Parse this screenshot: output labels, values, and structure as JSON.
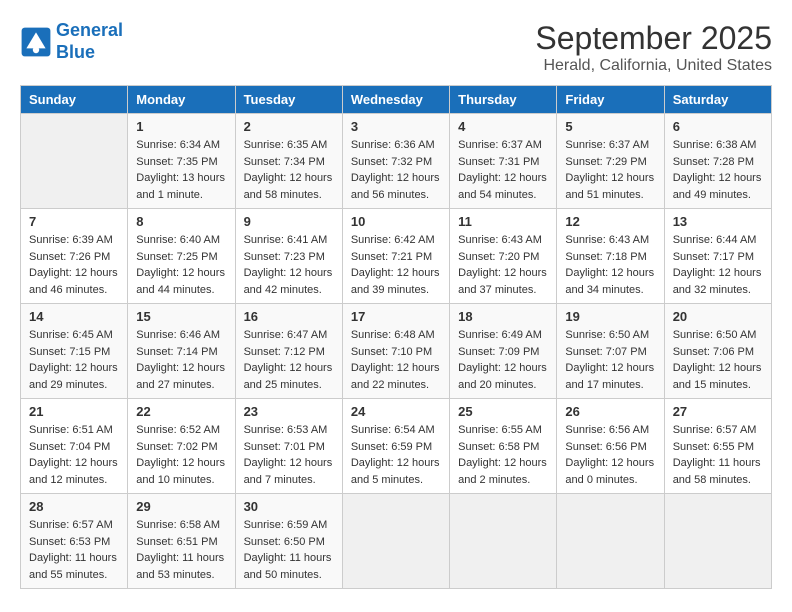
{
  "logo": {
    "line1": "General",
    "line2": "Blue"
  },
  "title": "September 2025",
  "subtitle": "Herald, California, United States",
  "days_of_week": [
    "Sunday",
    "Monday",
    "Tuesday",
    "Wednesday",
    "Thursday",
    "Friday",
    "Saturday"
  ],
  "weeks": [
    [
      {
        "day": "",
        "info": ""
      },
      {
        "day": "1",
        "info": "Sunrise: 6:34 AM\nSunset: 7:35 PM\nDaylight: 13 hours\nand 1 minute."
      },
      {
        "day": "2",
        "info": "Sunrise: 6:35 AM\nSunset: 7:34 PM\nDaylight: 12 hours\nand 58 minutes."
      },
      {
        "day": "3",
        "info": "Sunrise: 6:36 AM\nSunset: 7:32 PM\nDaylight: 12 hours\nand 56 minutes."
      },
      {
        "day": "4",
        "info": "Sunrise: 6:37 AM\nSunset: 7:31 PM\nDaylight: 12 hours\nand 54 minutes."
      },
      {
        "day": "5",
        "info": "Sunrise: 6:37 AM\nSunset: 7:29 PM\nDaylight: 12 hours\nand 51 minutes."
      },
      {
        "day": "6",
        "info": "Sunrise: 6:38 AM\nSunset: 7:28 PM\nDaylight: 12 hours\nand 49 minutes."
      }
    ],
    [
      {
        "day": "7",
        "info": "Sunrise: 6:39 AM\nSunset: 7:26 PM\nDaylight: 12 hours\nand 46 minutes."
      },
      {
        "day": "8",
        "info": "Sunrise: 6:40 AM\nSunset: 7:25 PM\nDaylight: 12 hours\nand 44 minutes."
      },
      {
        "day": "9",
        "info": "Sunrise: 6:41 AM\nSunset: 7:23 PM\nDaylight: 12 hours\nand 42 minutes."
      },
      {
        "day": "10",
        "info": "Sunrise: 6:42 AM\nSunset: 7:21 PM\nDaylight: 12 hours\nand 39 minutes."
      },
      {
        "day": "11",
        "info": "Sunrise: 6:43 AM\nSunset: 7:20 PM\nDaylight: 12 hours\nand 37 minutes."
      },
      {
        "day": "12",
        "info": "Sunrise: 6:43 AM\nSunset: 7:18 PM\nDaylight: 12 hours\nand 34 minutes."
      },
      {
        "day": "13",
        "info": "Sunrise: 6:44 AM\nSunset: 7:17 PM\nDaylight: 12 hours\nand 32 minutes."
      }
    ],
    [
      {
        "day": "14",
        "info": "Sunrise: 6:45 AM\nSunset: 7:15 PM\nDaylight: 12 hours\nand 29 minutes."
      },
      {
        "day": "15",
        "info": "Sunrise: 6:46 AM\nSunset: 7:14 PM\nDaylight: 12 hours\nand 27 minutes."
      },
      {
        "day": "16",
        "info": "Sunrise: 6:47 AM\nSunset: 7:12 PM\nDaylight: 12 hours\nand 25 minutes."
      },
      {
        "day": "17",
        "info": "Sunrise: 6:48 AM\nSunset: 7:10 PM\nDaylight: 12 hours\nand 22 minutes."
      },
      {
        "day": "18",
        "info": "Sunrise: 6:49 AM\nSunset: 7:09 PM\nDaylight: 12 hours\nand 20 minutes."
      },
      {
        "day": "19",
        "info": "Sunrise: 6:50 AM\nSunset: 7:07 PM\nDaylight: 12 hours\nand 17 minutes."
      },
      {
        "day": "20",
        "info": "Sunrise: 6:50 AM\nSunset: 7:06 PM\nDaylight: 12 hours\nand 15 minutes."
      }
    ],
    [
      {
        "day": "21",
        "info": "Sunrise: 6:51 AM\nSunset: 7:04 PM\nDaylight: 12 hours\nand 12 minutes."
      },
      {
        "day": "22",
        "info": "Sunrise: 6:52 AM\nSunset: 7:02 PM\nDaylight: 12 hours\nand 10 minutes."
      },
      {
        "day": "23",
        "info": "Sunrise: 6:53 AM\nSunset: 7:01 PM\nDaylight: 12 hours\nand 7 minutes."
      },
      {
        "day": "24",
        "info": "Sunrise: 6:54 AM\nSunset: 6:59 PM\nDaylight: 12 hours\nand 5 minutes."
      },
      {
        "day": "25",
        "info": "Sunrise: 6:55 AM\nSunset: 6:58 PM\nDaylight: 12 hours\nand 2 minutes."
      },
      {
        "day": "26",
        "info": "Sunrise: 6:56 AM\nSunset: 6:56 PM\nDaylight: 12 hours\nand 0 minutes."
      },
      {
        "day": "27",
        "info": "Sunrise: 6:57 AM\nSunset: 6:55 PM\nDaylight: 11 hours\nand 58 minutes."
      }
    ],
    [
      {
        "day": "28",
        "info": "Sunrise: 6:57 AM\nSunset: 6:53 PM\nDaylight: 11 hours\nand 55 minutes."
      },
      {
        "day": "29",
        "info": "Sunrise: 6:58 AM\nSunset: 6:51 PM\nDaylight: 11 hours\nand 53 minutes."
      },
      {
        "day": "30",
        "info": "Sunrise: 6:59 AM\nSunset: 6:50 PM\nDaylight: 11 hours\nand 50 minutes."
      },
      {
        "day": "",
        "info": ""
      },
      {
        "day": "",
        "info": ""
      },
      {
        "day": "",
        "info": ""
      },
      {
        "day": "",
        "info": ""
      }
    ]
  ]
}
